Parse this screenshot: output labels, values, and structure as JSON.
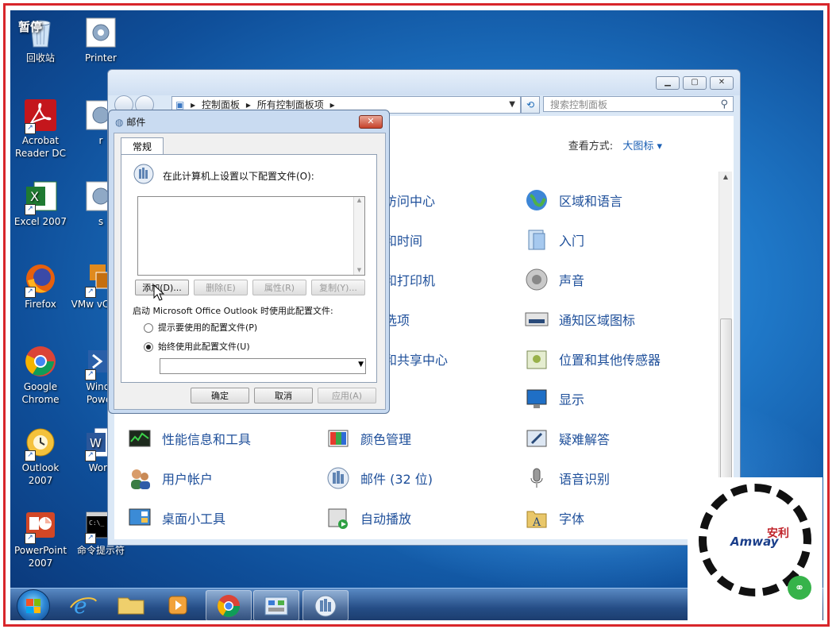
{
  "desktop": {
    "paused_label": "暂停",
    "icons": [
      {
        "name": "recycle-bin-desktop-icon",
        "label": "回收站"
      },
      {
        "name": "printer-desktop-icon",
        "label": "Printer"
      },
      {
        "name": "acrobat-desktop-icon",
        "label": "Acrobat Reader DC"
      },
      {
        "name": "partial-desktop-icon-r",
        "label": "r"
      },
      {
        "name": "excel-desktop-icon",
        "label": "Excel 2007"
      },
      {
        "name": "partial-desktop-icon-s",
        "label": "s"
      },
      {
        "name": "firefox-desktop-icon",
        "label": "Firefox"
      },
      {
        "name": "vmware-desktop-icon",
        "label": "VMw vCente"
      },
      {
        "name": "chrome-desktop-icon",
        "label": "Google Chrome"
      },
      {
        "name": "powershell-desktop-icon",
        "label": "Windo Power"
      },
      {
        "name": "outlook-desktop-icon",
        "label": "Outlook 2007"
      },
      {
        "name": "word-desktop-icon",
        "label": "Word"
      },
      {
        "name": "powerpoint-desktop-icon",
        "label": "PowerPoint 2007"
      },
      {
        "name": "cmd-desktop-icon",
        "label": "命令提示符"
      }
    ]
  },
  "control_panel": {
    "breadcrumb": [
      "控制面板",
      "所有控制面板项"
    ],
    "search_placeholder": "搜索控制面板",
    "view_by_label": "查看方式:",
    "view_by_value": "大图标",
    "items": [
      {
        "label": "访问中心"
      },
      {
        "label": "区域和语言"
      },
      {
        "label": "和时间"
      },
      {
        "label": "入门"
      },
      {
        "label": "和打印机"
      },
      {
        "label": "声音"
      },
      {
        "label": "选项"
      },
      {
        "label": "通知区域图标"
      },
      {
        "label": "和共享中心"
      },
      {
        "label": "位置和其他传感器"
      },
      {
        "label": "显示"
      },
      {
        "label": "性能信息和工具"
      },
      {
        "label": "颜色管理"
      },
      {
        "label": "疑难解答"
      },
      {
        "label": "用户帐户"
      },
      {
        "label": "邮件 (32 位)"
      },
      {
        "label": "语音识别"
      },
      {
        "label": "桌面小工具"
      },
      {
        "label": "自动播放"
      },
      {
        "label": "字体"
      }
    ]
  },
  "mail_dialog": {
    "title": "邮件",
    "tab": "常规",
    "profiles_label": "在此计算机上设置以下配置文件(O):",
    "buttons": {
      "add": "添加(D)...",
      "remove": "删除(E)",
      "properties": "属性(R)",
      "copy": "复制(Y)..."
    },
    "startup_label": "启动 Microsoft Office Outlook 时使用此配置文件:",
    "radio_prompt": "提示要使用的配置文件(P)",
    "radio_always": "始终使用此配置文件(U)",
    "ok": "确定",
    "cancel": "取消",
    "apply": "应用(A)"
  },
  "qr_overlay": {
    "brand": "Amway",
    "brand_cn": "安利"
  }
}
